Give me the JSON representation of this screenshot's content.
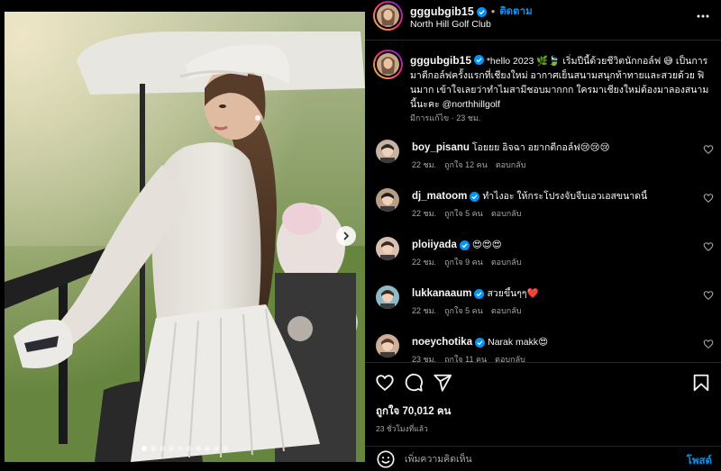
{
  "post": {
    "username": "gggubgib15",
    "follow_label": "ติดตาม",
    "separator": "•",
    "location": "North Hill Golf Club",
    "photo_dots": 10,
    "photo_active_dot": 0
  },
  "caption": {
    "username": "gggubgib15",
    "text": "*hello 2023 🌿🍃 เริ่มปีนี้ด้วยชีวิตนักกอล์ฟ 😅 เป็นการมาตีกอล์ฟครั้งแรกที่เชียงใหม่ อากาศเย็นสนามสนุกท้าทายและสวยด้วย ฟินมาก เข้าใจเลยว่าทำไมสามีชอบมากกก ใครมาเชียงใหม่ต้องมาลองสนามนี้นะคะ @northhillgolf",
    "meta": "มีการแก้ไข · 23 ชม."
  },
  "comments": [
    {
      "username": "boy_pisanu",
      "verified": false,
      "text": "โอยยย อิจฉา อยากตีกอล์ฟ😢😢😢",
      "time": "22 ชม.",
      "likes": "ถูกใจ 12 คน",
      "reply": "ตอบกลับ"
    },
    {
      "username": "dj_matoom",
      "verified": true,
      "text": "ทำไงอะ ให้กระโปรงจับจีบเอวเอสขนาดนี้",
      "time": "22 ชม.",
      "likes": "ถูกใจ 5 คน",
      "reply": "ตอบกลับ"
    },
    {
      "username": "ploiiyada",
      "verified": true,
      "text": "😍😍😍",
      "time": "22 ชม.",
      "likes": "ถูกใจ 9 คน",
      "reply": "ตอบกลับ"
    },
    {
      "username": "lukkanaaum",
      "verified": true,
      "text": "สวยขึ้นๆๆ❤️",
      "time": "22 ชม.",
      "likes": "ถูกใจ 5 คน",
      "reply": "ตอบกลับ"
    },
    {
      "username": "noeychotika",
      "verified": true,
      "text": "Narak makk😍",
      "time": "23 ชม.",
      "likes": "ถูกใจ 11 คน",
      "reply": "ตอบกลับ"
    }
  ],
  "actions": {
    "likes": "ถูกใจ 70,012 คน",
    "time_ago": "23 ชั่วโมงที่แล้ว",
    "input_placeholder": "เพิ่มความคิดเห็น",
    "post_label": "โพสต์"
  },
  "icons": {
    "verified": "verified-badge-icon",
    "more": "more-options-icon",
    "next": "chevron-right-icon",
    "like": "heart-icon",
    "comment": "comment-icon",
    "share": "share-icon",
    "save": "bookmark-icon",
    "emoji": "emoji-icon"
  },
  "colors": {
    "link_blue": "#0095f6",
    "verified_blue": "#0095f6",
    "meta_gray": "#a8a8a8",
    "divider": "#262626"
  }
}
